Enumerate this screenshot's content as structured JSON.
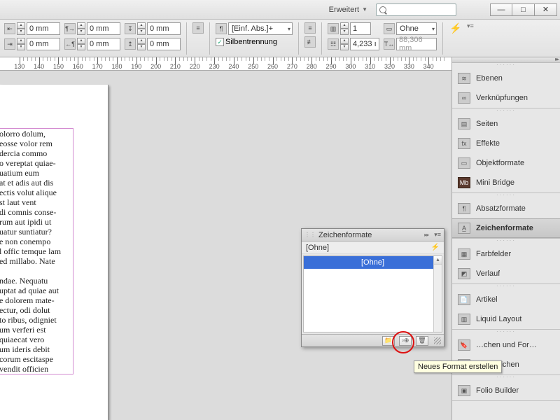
{
  "topbar": {
    "workspace": "Erweitert"
  },
  "ctrl": {
    "mm0": "0 mm",
    "para_style": "[Einf. Abs.]+",
    "hyphen_label": "Silbentrennung",
    "cols_val": "1",
    "obj_style": "Ohne",
    "height_val": "4,233 ı",
    "width_val": "88,306 mm"
  },
  "ruler": {
    "start": 130,
    "end": 340,
    "step": 10
  },
  "bodytext": {
    "p1": "olorro dolum,\neosse volor rem\ndercia commo\no vereptat quiae-\nuatium eum\nat et adis aut dis\nectis volut alique\nst laut vent\ndi comnis conse-\nrum aut ipidi ut\nuatur suntiatur?\ne non conempo\nl offic temque lam\ned millabo. Nate",
    "p2": "ndae. Nequatu\nuptat ad quiae aut\ne dolorem mate-\nectur, odi dolut\nto ribus, odigniet\num verferi est\nquiaecat vero\num ideris debit\ncorum escitaspe\nvendit officien"
  },
  "rightpanels": {
    "g1": [
      {
        "icon": "layers",
        "label": "Ebenen"
      },
      {
        "icon": "link",
        "label": "Verknüpfungen"
      }
    ],
    "g2": [
      {
        "icon": "pages",
        "label": "Seiten"
      },
      {
        "icon": "fx",
        "label": "Effekte"
      },
      {
        "icon": "obj",
        "label": "Objektformate"
      },
      {
        "icon": "mb",
        "label": "Mini Bridge"
      }
    ],
    "g3": [
      {
        "icon": "para",
        "label": "Absatzformate"
      },
      {
        "icon": "char",
        "label": "Zeichenformate",
        "selected": true
      }
    ],
    "g4": [
      {
        "icon": "swatch",
        "label": "Farbfelder"
      },
      {
        "icon": "grad",
        "label": "Verlauf"
      }
    ],
    "g5": [
      {
        "icon": "art",
        "label": "Artikel"
      },
      {
        "icon": "liq",
        "label": "Liquid Layout"
      }
    ],
    "g6": [
      {
        "icon": "bkf",
        "label": "…chen und For…"
      },
      {
        "icon": "bm",
        "label": "Lesezeichen"
      }
    ],
    "g7": [
      {
        "icon": "fb",
        "label": "Folio Builder"
      }
    ]
  },
  "floatpanel": {
    "title": "Zeichenformate",
    "row_none": "[Ohne]",
    "sel_none": "[Ohne]"
  },
  "tooltip": "Neues Format erstellen"
}
